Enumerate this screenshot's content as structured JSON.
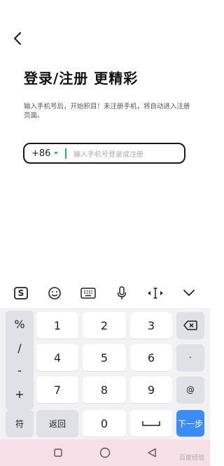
{
  "header": {
    "back_icon": "chevron-left-icon"
  },
  "main": {
    "title": "登录/注册 更精彩",
    "description": "输入手机号后，开始积目！未注册手机，将自动进入注册页面。",
    "country_code": "+86",
    "phone_placeholder": "输入手机号登录或注册"
  },
  "keyboard_toolbar": {
    "icons": [
      "sogou-logo-icon",
      "emoji-icon",
      "keyboard-icon",
      "microphone-icon",
      "cursor-move-icon",
      "collapse-chevron-icon"
    ],
    "logo_text": "S"
  },
  "keyboard": {
    "symbols": [
      "%",
      "/",
      "-",
      "+"
    ],
    "digits": [
      "1",
      "2",
      "3",
      "4",
      "5",
      "6",
      "7",
      "8",
      "9",
      "0"
    ],
    "dot": "·",
    "at": "@",
    "fu": "符",
    "back": "返回",
    "next": "下一步"
  },
  "navbar": {
    "icons": [
      "recent-apps-icon",
      "home-icon",
      "back-icon"
    ]
  },
  "watermark": {
    "text": "百度经验"
  },
  "colors": {
    "accent": "#2bb673",
    "next_key": "#3c8cf6",
    "navbar_bg": "#f6dfe6"
  }
}
